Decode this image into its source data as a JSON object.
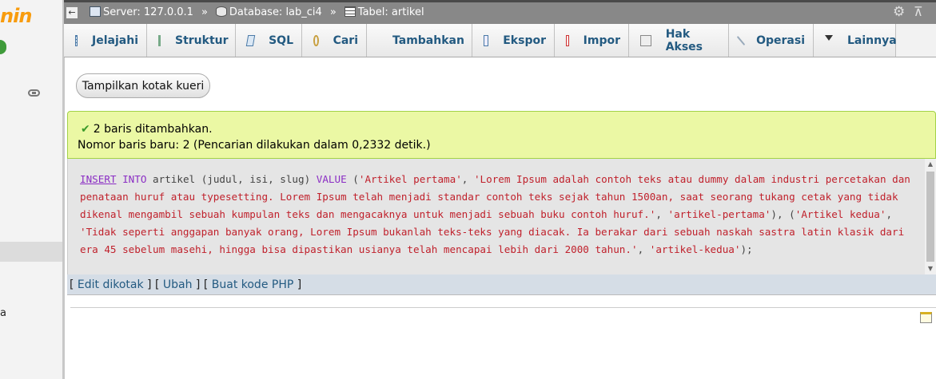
{
  "nav": {
    "logo_text": "nin",
    "bottom_text": "a"
  },
  "breadcrumb": {
    "server": "Server: 127.0.0.1",
    "database": "Database: lab_ci4",
    "table": "Tabel: artikel",
    "separator": "»"
  },
  "tabs": [
    {
      "label": "Jelajahi",
      "icon": "browse-icon"
    },
    {
      "label": "Struktur",
      "icon": "structure-icon"
    },
    {
      "label": "SQL",
      "icon": "sql-icon"
    },
    {
      "label": "Cari",
      "icon": "search-icon"
    },
    {
      "label": "Tambahkan",
      "icon": "insert-icon"
    },
    {
      "label": "Ekspor",
      "icon": "export-icon"
    },
    {
      "label": "Impor",
      "icon": "import-icon"
    },
    {
      "label": "Hak Akses",
      "icon": "privileges-icon"
    },
    {
      "label": "Operasi",
      "icon": "operations-icon"
    },
    {
      "label": "Lainnya",
      "icon": "more-dropdown-icon"
    }
  ],
  "query_button": "Tampilkan kotak kueri",
  "message": {
    "line1": "2 baris ditambahkan.",
    "line2": "Nomor baris baru: 2 (Pencarian dilakukan dalam 0,2332 detik.)"
  },
  "sql": {
    "kw_insert": "INSERT",
    "kw_into": "INTO",
    "table_cols": "artikel (judul, isi, slug)",
    "kw_value": "VALUE",
    "val_title1": "'Artikel pertama'",
    "val_body1": "'Lorem Ipsum adalah contoh teks atau dummy dalam industri percetakan dan penataan huruf atau typesetting. Lorem Ipsum telah menjadi standar contoh teks sejak tahun 1500an, saat seorang tukang cetak yang tidak dikenal mengambil sebuah kumpulan teks dan mengacaknya untuk menjadi sebuah buku contoh huruf.'",
    "val_slug1": "'artikel-pertama'",
    "val_title2": "'Artikel kedua'",
    "val_body2": "'Tidak seperti anggapan banyak orang, Lorem Ipsum bukanlah teks-teks yang diacak. Ia berakar dari sebuah naskah sastra latin klasik dari era 45 sebelum masehi, hingga bisa dipastikan usianya telah mencapai lebih dari 2000 tahun.'",
    "val_slug2": "'artikel-kedua'"
  },
  "actions": {
    "edit_inline": "Edit dikotak",
    "edit": "Ubah",
    "create_php": "Buat kode PHP"
  },
  "colors": {
    "success_bg": "#ebf8a4",
    "link": "#235a81",
    "sql_string": "#c0212c",
    "sql_keyword": "#8b2ec4"
  }
}
